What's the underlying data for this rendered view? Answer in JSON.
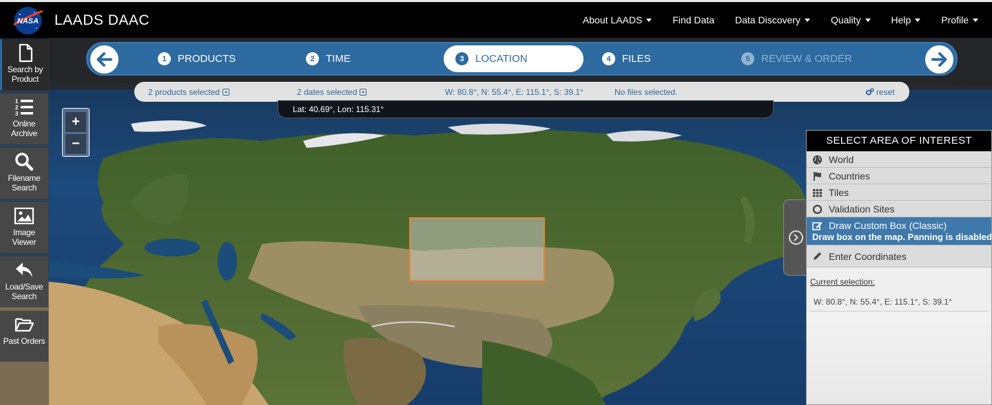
{
  "header": {
    "logo_text": "NASA",
    "app_title": "LAADS DAAC",
    "nav": [
      "About LAADS",
      "Find Data",
      "Data Discovery",
      "Quality",
      "Help",
      "Profile"
    ]
  },
  "steps": {
    "items": [
      {
        "num": "1",
        "label": "PRODUCTS"
      },
      {
        "num": "2",
        "label": "TIME"
      },
      {
        "num": "3",
        "label": "LOCATION"
      },
      {
        "num": "4",
        "label": "FILES"
      },
      {
        "num": "5",
        "label": "REVIEW & ORDER"
      }
    ],
    "active": "LOCATION"
  },
  "summary": {
    "products": "2 products selected",
    "dates": "2 dates selected",
    "coords": "W: 80.8°, N: 55.4°, E: 115.1°, S: 39.1°",
    "files": "No files selected.",
    "reset": "reset"
  },
  "map": {
    "latlon": "Lat: 40.69°, Lon: 115.31°",
    "zoom_in": "+",
    "zoom_out": "−"
  },
  "toolbar": [
    {
      "line1": "Search by",
      "line2": "Product",
      "icon": "file-icon"
    },
    {
      "line1": "Online",
      "line2": "Archive",
      "icon": "list-ol-icon"
    },
    {
      "line1": "Filename",
      "line2": "Search",
      "icon": "search-icon"
    },
    {
      "line1": "Image",
      "line2": "Viewer",
      "icon": "image-icon"
    },
    {
      "line1": "Load/Save",
      "line2": "Search",
      "icon": "reply-icon"
    },
    {
      "line1": "Past Orders",
      "line2": "",
      "icon": "folder-open-icon"
    }
  ],
  "aoi": {
    "title": "SELECT AREA OF INTEREST",
    "options": [
      {
        "label": "World",
        "icon": "globe-icon"
      },
      {
        "label": "Countries",
        "icon": "flag-icon"
      },
      {
        "label": "Tiles",
        "icon": "grid-icon"
      },
      {
        "label": "Validation Sites",
        "icon": "circle-icon"
      }
    ],
    "draw_label": "Draw Custom Box (Classic)",
    "draw_sub": "Draw box on the map. Panning is disabled.",
    "enter_label": "Enter Coordinates",
    "current_selection_label": "Current selection:",
    "current_selection_value": "W: 80.8°, N: 55.4°, E: 115.1°, S: 39.1°"
  },
  "colors": {
    "accent": "#2d6aa0",
    "selection_border": "#e8843a",
    "header_bg": "#000000"
  }
}
